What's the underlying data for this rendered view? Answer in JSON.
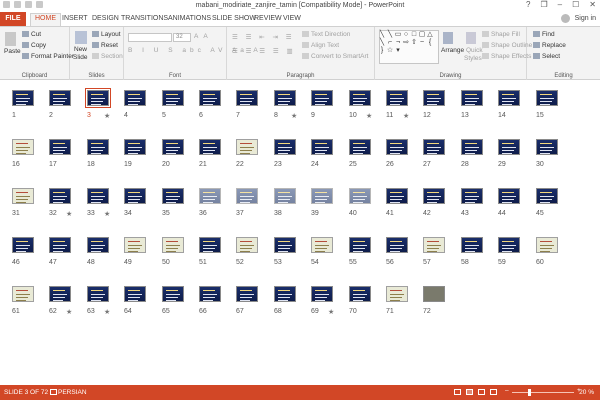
{
  "window": {
    "title": "mabani_modiriate_zanjire_tamin [Compatibility Mode] - PowerPoint",
    "controls": [
      "?",
      "❐",
      "–",
      "☐",
      "✕"
    ]
  },
  "tabs": {
    "file": "FILE",
    "items": [
      "HOME",
      "INSERT",
      "DESIGN",
      "TRANSITIONS",
      "ANIMATIONS",
      "SLIDE SHOW",
      "REVIEW",
      "VIEW"
    ],
    "active": "HOME",
    "sign_in": "Sign in"
  },
  "ribbon": {
    "clipboard": {
      "label": "Clipboard",
      "paste": "Paste",
      "cut": "Cut",
      "copy": "Copy",
      "format_painter": "Format Painter"
    },
    "slides": {
      "label": "Slides",
      "new_slide": "New",
      "new_slide2": "Slide",
      "layout": "Layout",
      "reset": "Reset",
      "section": "Section"
    },
    "font": {
      "label": "Font",
      "font_size": "32"
    },
    "paragraph": {
      "label": "Paragraph",
      "text_direction": "Text Direction",
      "align_text": "Align Text",
      "convert_smartart": "Convert to SmartArt"
    },
    "drawing": {
      "label": "Drawing",
      "arrange": "Arrange",
      "quick_styles": "Quick",
      "quick_styles2": "Styles",
      "shape_fill": "Shape Fill",
      "shape_outline": "Shape Outline",
      "shape_effects": "Shape Effects"
    },
    "editing": {
      "label": "Editing",
      "find": "Find",
      "replace": "Replace",
      "select": "Select"
    }
  },
  "slides": [
    {
      "n": "1",
      "style": "dark",
      "star": false
    },
    {
      "n": "2",
      "style": "dark",
      "star": false
    },
    {
      "n": "3",
      "style": "dark",
      "star": true,
      "selected": true
    },
    {
      "n": "4",
      "style": "dark",
      "star": false
    },
    {
      "n": "5",
      "style": "dark",
      "star": false
    },
    {
      "n": "6",
      "style": "dark",
      "star": false
    },
    {
      "n": "7",
      "style": "dark",
      "star": false
    },
    {
      "n": "8",
      "style": "dark",
      "star": true
    },
    {
      "n": "9",
      "style": "dark",
      "star": false
    },
    {
      "n": "10",
      "style": "dark",
      "star": true
    },
    {
      "n": "11",
      "style": "dark",
      "star": true
    },
    {
      "n": "12",
      "style": "dark",
      "star": false
    },
    {
      "n": "13",
      "style": "dark",
      "star": false
    },
    {
      "n": "14",
      "style": "dark",
      "star": false
    },
    {
      "n": "15",
      "style": "dark",
      "star": false
    },
    {
      "n": "16",
      "style": "light",
      "star": false
    },
    {
      "n": "17",
      "style": "dark",
      "star": false
    },
    {
      "n": "18",
      "style": "dark",
      "star": false
    },
    {
      "n": "19",
      "style": "dark",
      "star": false
    },
    {
      "n": "20",
      "style": "dark",
      "star": false
    },
    {
      "n": "21",
      "style": "dark",
      "star": false
    },
    {
      "n": "22",
      "style": "light",
      "star": false
    },
    {
      "n": "23",
      "style": "dark",
      "star": false
    },
    {
      "n": "24",
      "style": "dark",
      "star": false
    },
    {
      "n": "25",
      "style": "dark",
      "star": false
    },
    {
      "n": "26",
      "style": "dark",
      "star": false
    },
    {
      "n": "27",
      "style": "dark",
      "star": false
    },
    {
      "n": "28",
      "style": "dark",
      "star": false
    },
    {
      "n": "29",
      "style": "dark",
      "star": false
    },
    {
      "n": "30",
      "style": "dark",
      "star": false
    },
    {
      "n": "31",
      "style": "light",
      "star": false
    },
    {
      "n": "32",
      "style": "dark",
      "star": true
    },
    {
      "n": "33",
      "style": "dark",
      "star": true
    },
    {
      "n": "34",
      "style": "dark",
      "star": false
    },
    {
      "n": "35",
      "style": "dark",
      "star": false
    },
    {
      "n": "36",
      "style": "faded",
      "star": false
    },
    {
      "n": "37",
      "style": "faded",
      "star": false
    },
    {
      "n": "38",
      "style": "faded",
      "star": false
    },
    {
      "n": "39",
      "style": "faded",
      "star": false
    },
    {
      "n": "40",
      "style": "faded",
      "star": false
    },
    {
      "n": "41",
      "style": "dark",
      "star": false
    },
    {
      "n": "42",
      "style": "dark",
      "star": false
    },
    {
      "n": "43",
      "style": "dark",
      "star": false
    },
    {
      "n": "44",
      "style": "dark",
      "star": false
    },
    {
      "n": "45",
      "style": "dark",
      "star": false
    },
    {
      "n": "46",
      "style": "dark",
      "star": false
    },
    {
      "n": "47",
      "style": "dark",
      "star": false
    },
    {
      "n": "48",
      "style": "dark",
      "star": false
    },
    {
      "n": "49",
      "style": "light",
      "star": false
    },
    {
      "n": "50",
      "style": "light",
      "star": false
    },
    {
      "n": "51",
      "style": "dark",
      "star": false
    },
    {
      "n": "52",
      "style": "light",
      "star": false
    },
    {
      "n": "53",
      "style": "dark",
      "star": false
    },
    {
      "n": "54",
      "style": "light",
      "star": false
    },
    {
      "n": "55",
      "style": "dark",
      "star": false
    },
    {
      "n": "56",
      "style": "dark",
      "star": false
    },
    {
      "n": "57",
      "style": "light",
      "star": false
    },
    {
      "n": "58",
      "style": "dark",
      "star": false
    },
    {
      "n": "59",
      "style": "dark",
      "star": false
    },
    {
      "n": "60",
      "style": "light",
      "star": false
    },
    {
      "n": "61",
      "style": "light",
      "star": false
    },
    {
      "n": "62",
      "style": "dark",
      "star": true
    },
    {
      "n": "63",
      "style": "dark",
      "star": true
    },
    {
      "n": "64",
      "style": "dark",
      "star": false
    },
    {
      "n": "65",
      "style": "dark",
      "star": false
    },
    {
      "n": "66",
      "style": "dark",
      "star": false
    },
    {
      "n": "67",
      "style": "dark",
      "star": false
    },
    {
      "n": "68",
      "style": "dark",
      "star": false
    },
    {
      "n": "69",
      "style": "dark",
      "star": true
    },
    {
      "n": "70",
      "style": "dark",
      "star": false
    },
    {
      "n": "71",
      "style": "light",
      "star": false
    },
    {
      "n": "72",
      "style": "photo",
      "star": false
    }
  ],
  "star_glyph": "★",
  "status": {
    "slide": "SLIDE 3 OF 72",
    "language": "PERSIAN",
    "zoom": "20 %",
    "zoom_fraction": 0.2
  },
  "colors": {
    "accent": "#d24726",
    "slide_dark": "#1a2e6a",
    "slide_light": "#e9ead6"
  }
}
